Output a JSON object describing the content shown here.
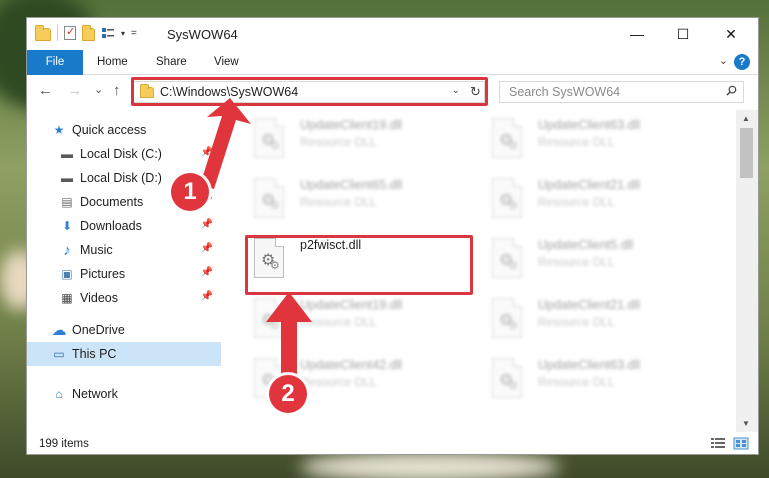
{
  "window": {
    "title": "SysWOW64",
    "minimize_glyph": "—",
    "maximize_glyph": "☐",
    "close_glyph": "✕"
  },
  "ribbon": {
    "tabs": [
      "File",
      "Home",
      "Share",
      "View"
    ],
    "help_glyph": "?",
    "collapse_glyph": "⌄"
  },
  "nav": {
    "back_glyph": "←",
    "forward_glyph": "→",
    "recent_glyph": "⌄",
    "up_glyph": "↑",
    "address": "C:\\Windows\\SysWOW64",
    "address_dropdown_glyph": "⌄",
    "refresh_glyph": "↻",
    "search_placeholder": "Search SysWOW64"
  },
  "sidebar": {
    "items": [
      {
        "label": "Quick access",
        "icon": "star-icon",
        "glyph": "★",
        "pinned": false
      },
      {
        "label": "Local Disk (C:)",
        "icon": "drive-icon",
        "glyph": "▬",
        "pinned": true
      },
      {
        "label": "Local Disk (D:)",
        "icon": "drive-icon",
        "glyph": "▬",
        "pinned": true
      },
      {
        "label": "Documents",
        "icon": "documents-icon",
        "glyph": "▤",
        "pinned": true
      },
      {
        "label": "Downloads",
        "icon": "download-icon",
        "glyph": "⬇",
        "pinned": true
      },
      {
        "label": "Music",
        "icon": "music-icon",
        "glyph": "♪",
        "pinned": true
      },
      {
        "label": "Pictures",
        "icon": "pictures-icon",
        "glyph": "▣",
        "pinned": true
      },
      {
        "label": "Videos",
        "icon": "videos-icon",
        "glyph": "▦",
        "pinned": true
      },
      {
        "label": "OneDrive",
        "icon": "cloud-icon",
        "glyph": "☁",
        "pinned": false
      },
      {
        "label": "This PC",
        "icon": "computer-icon",
        "glyph": "▭",
        "pinned": false
      },
      {
        "label": "Network",
        "icon": "network-icon",
        "glyph": "⌂",
        "pinned": false
      }
    ],
    "pin_glyph": "📌"
  },
  "files": [
    {
      "name": "UpdateClient19.dll",
      "type": "Resource DLL"
    },
    {
      "name": "UpdateClient63.dll",
      "type": "Resource DLL"
    },
    {
      "name": "UpdateClient65.dll",
      "type": "Resource DLL"
    },
    {
      "name": "UpdateClient21.dll",
      "type": "Resource DLL"
    },
    {
      "name": "p2fwisct.dll",
      "type": ""
    },
    {
      "name": "UpdateClient5.dll",
      "type": "Resource DLL"
    },
    {
      "name": "UpdateClient19.dll",
      "type": "Resource DLL"
    },
    {
      "name": "UpdateClient21.dll",
      "type": "Resource DLL"
    },
    {
      "name": "UpdateClient42.dll",
      "type": "Resource DLL"
    },
    {
      "name": "UpdateClient63.dll",
      "type": "Resource DLL"
    }
  ],
  "status": {
    "item_count": "199 items"
  },
  "annotations": {
    "step1": "1",
    "step2": "2",
    "color": "#d9363e"
  }
}
